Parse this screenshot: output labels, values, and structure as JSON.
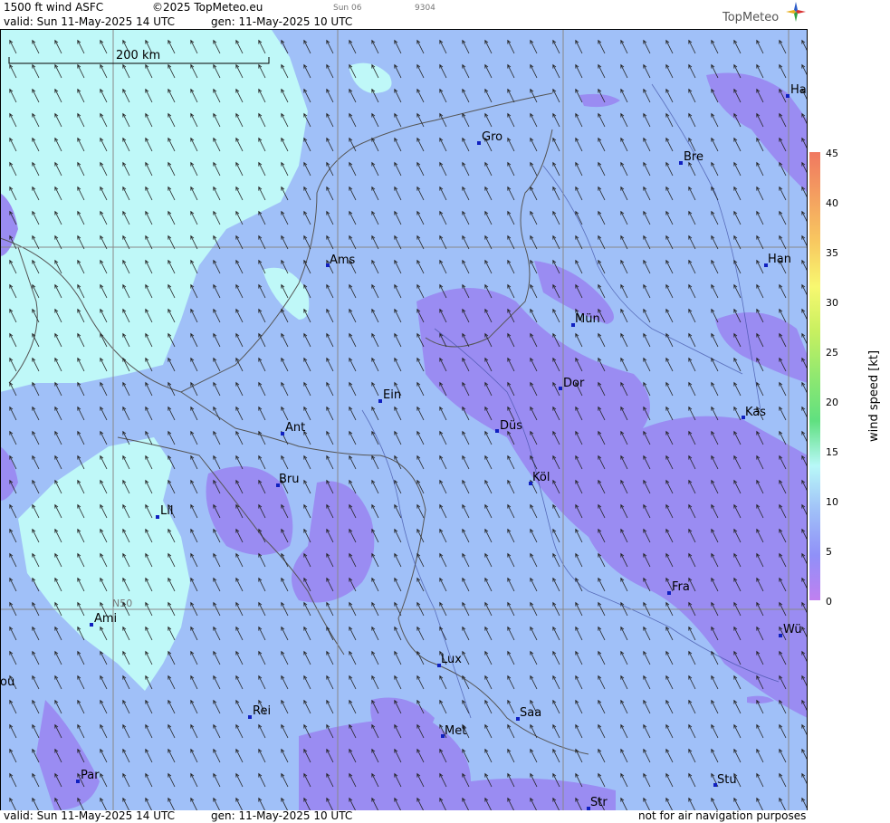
{
  "header": {
    "product": "1500 ft wind ASFC",
    "copyright": "©2025 TopMeteo.eu",
    "day_code": "Sun 06",
    "run_code": "9304",
    "valid": "valid:  Sun  11-May-2025  14 UTC",
    "gen": "gen: 11-May-2025 10 UTC",
    "logo": "TopMeteo"
  },
  "scale_bar": "200 km",
  "lat_label": "N50",
  "cities": [
    {
      "label": "Ha"
    },
    {
      "label": "Gro"
    },
    {
      "label": "Bre"
    },
    {
      "label": "Ams"
    },
    {
      "label": "Han"
    },
    {
      "label": "Mün"
    },
    {
      "label": "Ein"
    },
    {
      "label": "Dor"
    },
    {
      "label": "Ant"
    },
    {
      "label": "Düs"
    },
    {
      "label": "Kas"
    },
    {
      "label": "Bru"
    },
    {
      "label": "Köl"
    },
    {
      "label": "Lil"
    },
    {
      "label": "Fra"
    },
    {
      "label": "Ami"
    },
    {
      "label": "Wü"
    },
    {
      "label": "Lux"
    },
    {
      "label": "ou"
    },
    {
      "label": "Rei"
    },
    {
      "label": "Saa"
    },
    {
      "label": "Met"
    },
    {
      "label": "Par"
    },
    {
      "label": "Stu"
    },
    {
      "label": "Str"
    }
  ],
  "legend": {
    "title": "wind speed [kt]",
    "ticks": [
      "45",
      "40",
      "35",
      "30",
      "25",
      "20",
      "15",
      "10",
      "5",
      "0"
    ],
    "colors": [
      "#f07860",
      "#f4a060",
      "#f8c860",
      "#f8f870",
      "#c8f060",
      "#90e870",
      "#60e080",
      "#b8f8f8",
      "#a0c0f8",
      "#9090f8",
      "#c080f0"
    ]
  },
  "colors": {
    "calm_light": "#bff8f8",
    "medium": "#a0c0f8",
    "strong": "#9a8cf2",
    "grid": "#888888",
    "border": "#555555"
  },
  "footer": {
    "valid": "valid:  Sun  11-May-2025  14 UTC",
    "gen": "gen: 11-May-2025 10 UTC",
    "disclaimer": "not for air navigation purposes"
  }
}
